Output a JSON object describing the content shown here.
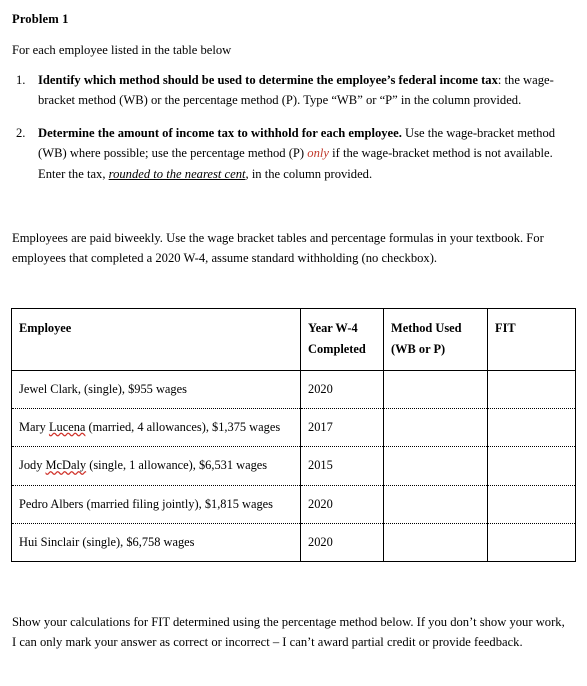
{
  "document": {
    "heading": "Problem 1",
    "intro": "For each employee listed in the table below",
    "tasks": [
      {
        "marker": "1.",
        "lead": "Identify which method should be used to determine the employee’s federal income tax",
        "rest_a": ": the wage-bracket method (WB) or the percentage method (P).  Type “WB” or “P” in the column provided."
      },
      {
        "marker": "2.",
        "lead": "Determine the amount of income tax to withhold for each employee.",
        "rest_a": "  Use the wage-bracket method (WB) where possible; use the percentage method (P) ",
        "emphasis_red": "only",
        "rest_b": " if the wage-bracket method is not available.  Enter the tax, ",
        "emphasis_underline": "rounded to the nearest cent",
        "rest_c": ", in the column provided."
      }
    ],
    "paragraph_biweekly": "Employees are paid biweekly.  Use the wage bracket tables and percentage formulas in your textbook.  For employees that completed a 2020 W-4, assume standard withholding (no checkbox).",
    "paragraph_closing": "Show your calculations for FIT determined using the percentage method below.  If you don’t show your work, I can only mark your answer as correct or incorrect – I can’t award partial credit or provide feedback."
  },
  "table": {
    "headers": [
      {
        "line1": "Employee",
        "line2": ""
      },
      {
        "line1": "Year W-4",
        "line2": "Completed"
      },
      {
        "line1": "Method Used",
        "line2": "(WB or P)"
      },
      {
        "line1": "FIT",
        "line2": ""
      }
    ],
    "rows": [
      {
        "employee_pre": "Jewel Clark, (single), $955 wages",
        "employee_misspelled": "",
        "employee_post": "",
        "year": "2020",
        "method": "",
        "fit": ""
      },
      {
        "employee_pre": "Mary ",
        "employee_misspelled": "Lucena",
        "employee_post": " (married, 4 allowances), $1,375 wages",
        "year": "2017",
        "method": "",
        "fit": ""
      },
      {
        "employee_pre": "Jody ",
        "employee_misspelled": "McDaly",
        "employee_post": " (single, 1 allowance), $6,531 wages",
        "year": "2015",
        "method": "",
        "fit": ""
      },
      {
        "employee_pre": "Pedro Albers (married filing jointly), $1,815 wages",
        "employee_misspelled": "",
        "employee_post": "",
        "year": "2020",
        "method": "",
        "fit": ""
      },
      {
        "employee_pre": "Hui Sinclair (single), $6,758 wages",
        "employee_misspelled": "",
        "employee_post": "",
        "year": "2020",
        "method": "",
        "fit": ""
      }
    ]
  },
  "colors": {
    "emphasis_red": "#c0392b",
    "spellcheck_underline": "#d0342c",
    "text": "#000000",
    "background": "#ffffff",
    "border": "#000000"
  }
}
